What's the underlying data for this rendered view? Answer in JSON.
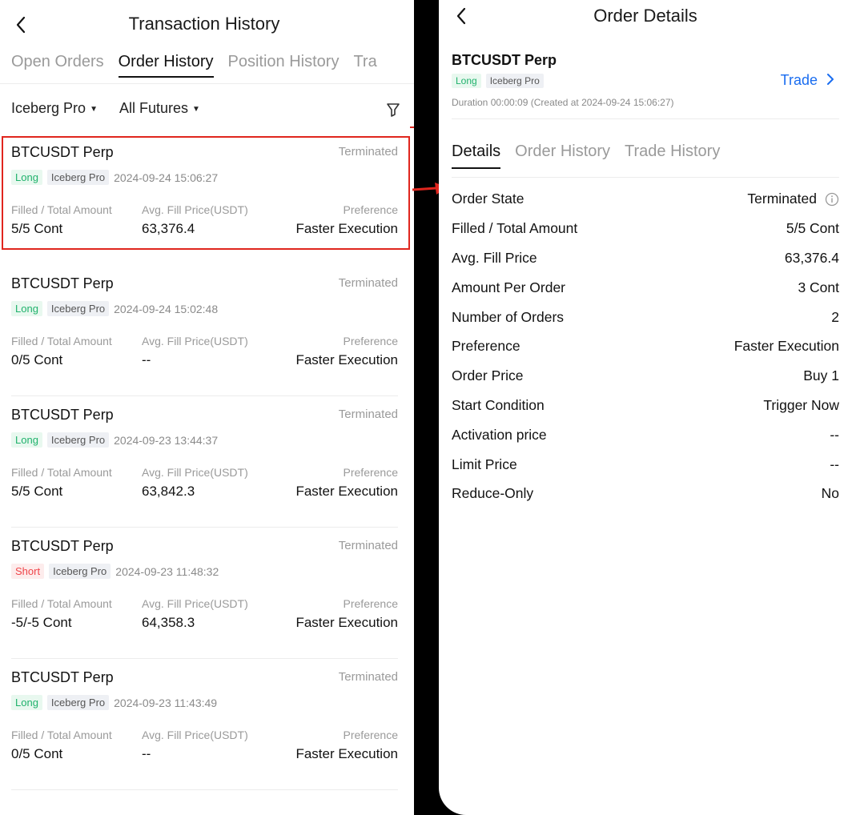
{
  "left": {
    "title": "Transaction History",
    "tabs": [
      "Open Orders",
      "Order History",
      "Position History",
      "Tra"
    ],
    "active_tab": "Order History",
    "filters": {
      "type": "Iceberg Pro",
      "market": "All Futures"
    },
    "labels": {
      "filled": "Filled / Total Amount",
      "avg": "Avg. Fill Price(USDT)",
      "pref": "Preference"
    },
    "orders": [
      {
        "symbol": "BTCUSDT Perp",
        "status": "Terminated",
        "side": "Long",
        "type": "Iceberg Pro",
        "time": "2024-09-24 15:06:27",
        "filled": "5/5 Cont",
        "avg": "63,376.4",
        "pref": "Faster Execution"
      },
      {
        "symbol": "BTCUSDT Perp",
        "status": "Terminated",
        "side": "Long",
        "type": "Iceberg Pro",
        "time": "2024-09-24 15:02:48",
        "filled": "0/5 Cont",
        "avg": "--",
        "pref": "Faster Execution"
      },
      {
        "symbol": "BTCUSDT Perp",
        "status": "Terminated",
        "side": "Long",
        "type": "Iceberg Pro",
        "time": "2024-09-23 13:44:37",
        "filled": "5/5 Cont",
        "avg": "63,842.3",
        "pref": "Faster Execution"
      },
      {
        "symbol": "BTCUSDT Perp",
        "status": "Terminated",
        "side": "Short",
        "type": "Iceberg Pro",
        "time": "2024-09-23 11:48:32",
        "filled": "-5/-5 Cont",
        "avg": "64,358.3",
        "pref": "Faster Execution"
      },
      {
        "symbol": "BTCUSDT Perp",
        "status": "Terminated",
        "side": "Long",
        "type": "Iceberg Pro",
        "time": "2024-09-23 11:43:49",
        "filled": "0/5 Cont",
        "avg": "--",
        "pref": "Faster Execution"
      }
    ]
  },
  "right": {
    "title": "Order Details",
    "symbol": "BTCUSDT Perp",
    "side": "Long",
    "type": "Iceberg Pro",
    "trade_label": "Trade",
    "duration": "Duration 00:00:09 (Created at 2024-09-24 15:06:27)",
    "tabs": [
      "Details",
      "Order History",
      "Trade History"
    ],
    "active_tab": "Details",
    "details": [
      {
        "label": "Order State",
        "value": "Terminated",
        "info": true
      },
      {
        "label": "Filled / Total Amount",
        "value": "5/5 Cont"
      },
      {
        "label": "Avg. Fill Price",
        "value": "63,376.4"
      },
      {
        "label": "Amount Per Order",
        "value": "3 Cont"
      },
      {
        "label": "Number of Orders",
        "value": "2"
      },
      {
        "label": "Preference",
        "value": "Faster Execution"
      },
      {
        "label": "Order Price",
        "value": "Buy 1"
      },
      {
        "label": "Start Condition",
        "value": "Trigger Now"
      },
      {
        "label": "Activation price",
        "value": "--"
      },
      {
        "label": "Limit Price",
        "value": "--"
      },
      {
        "label": "Reduce-Only",
        "value": "No"
      }
    ]
  },
  "colors": {
    "long": "#20b26c",
    "short": "#ef454a",
    "link": "#1a6df0",
    "highlight": "#e0261e"
  }
}
